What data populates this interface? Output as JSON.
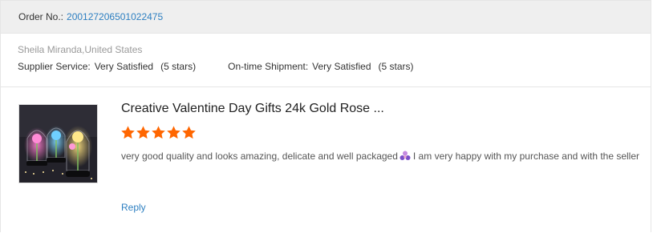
{
  "order": {
    "label": "Order No.:",
    "number": "200127206501022475"
  },
  "buyer": {
    "name_location": "Sheila Miranda,United States"
  },
  "ratings": [
    {
      "label": "Supplier Service:",
      "value": "Very Satisfied",
      "stars": "(5 stars)"
    },
    {
      "label": "On-time Shipment:",
      "value": "Very Satisfied",
      "stars": "(5 stars)"
    }
  ],
  "review": {
    "product_title": "Creative Valentine Day Gifts 24k Gold Rose ...",
    "star_rating": 5,
    "star_color": "#ff6600",
    "comment_part1": "very good quality and looks amazing, delicate and well packaged",
    "emoji_icon": "purple-flower-emoji-icon",
    "comment_part2": "I am very happy with my purchase and with the seller",
    "reply_label": "Reply"
  },
  "colors": {
    "link": "#2d7fc1",
    "header_bg": "#efefef"
  }
}
